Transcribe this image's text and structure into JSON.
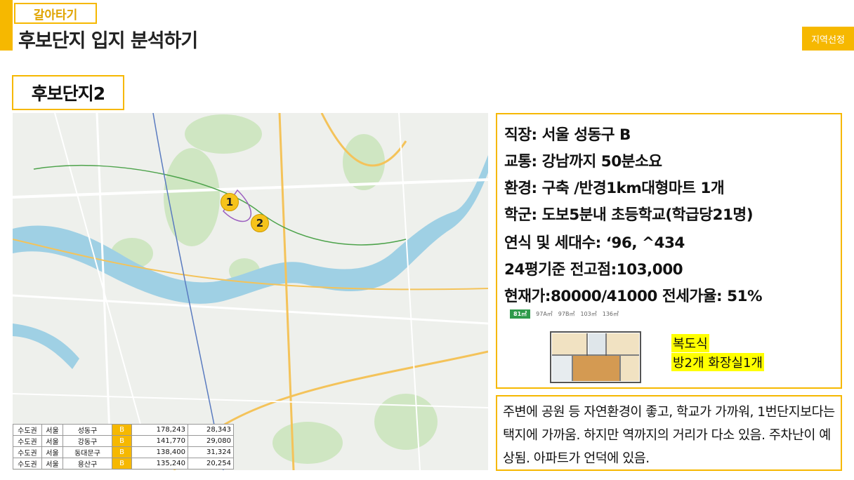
{
  "header": {
    "tag": "갈아타기",
    "title": "후보단지 입지 분석하기",
    "region_button": "지역선정"
  },
  "complex": {
    "name": "후보단지2"
  },
  "map": {
    "markers": [
      "1",
      "2"
    ],
    "colors": {
      "river": "#9fd0e4",
      "park": "#cfe6c2",
      "road": "#f4c35a"
    }
  },
  "stats_table": {
    "rows": [
      [
        "수도권",
        "서울",
        "성동구",
        "B",
        "178,243",
        "28,343"
      ],
      [
        "수도권",
        "서울",
        "강동구",
        "B",
        "141,770",
        "29,080"
      ],
      [
        "수도권",
        "서울",
        "동대문구",
        "B",
        "138,400",
        "31,324"
      ],
      [
        "수도권",
        "서울",
        "용산구",
        "B",
        "135,240",
        "20,254"
      ]
    ]
  },
  "info": {
    "lines": [
      "직장: 서울 성동구 B",
      "교통: 강남까지 50분소요",
      "환경: 구축 /반경1km대형마트 1개",
      "학군: 도보5분내 초등학교(학급당21명)",
      "연식 및 세대수: ‘96, ^434",
      "24평기준 전고점:103,000",
      "현재가:80000/41000  전세가율: 51%"
    ],
    "floor_tabs": [
      "81㎡",
      "97A㎡",
      "97B㎡",
      "103㎡",
      "136㎡"
    ],
    "highlight": [
      "복도식",
      "방2개 화장실1개"
    ]
  },
  "comment": "주변에 공원 등 자연환경이 좋고, 학교가 가까워, 1번단지보다는 택지에 가까움. 하지만 역까지의 거리가 다소 있음. 주차난이 예상됨. 아파트가 언덕에 있음.",
  "accent_color": "#f6b800"
}
